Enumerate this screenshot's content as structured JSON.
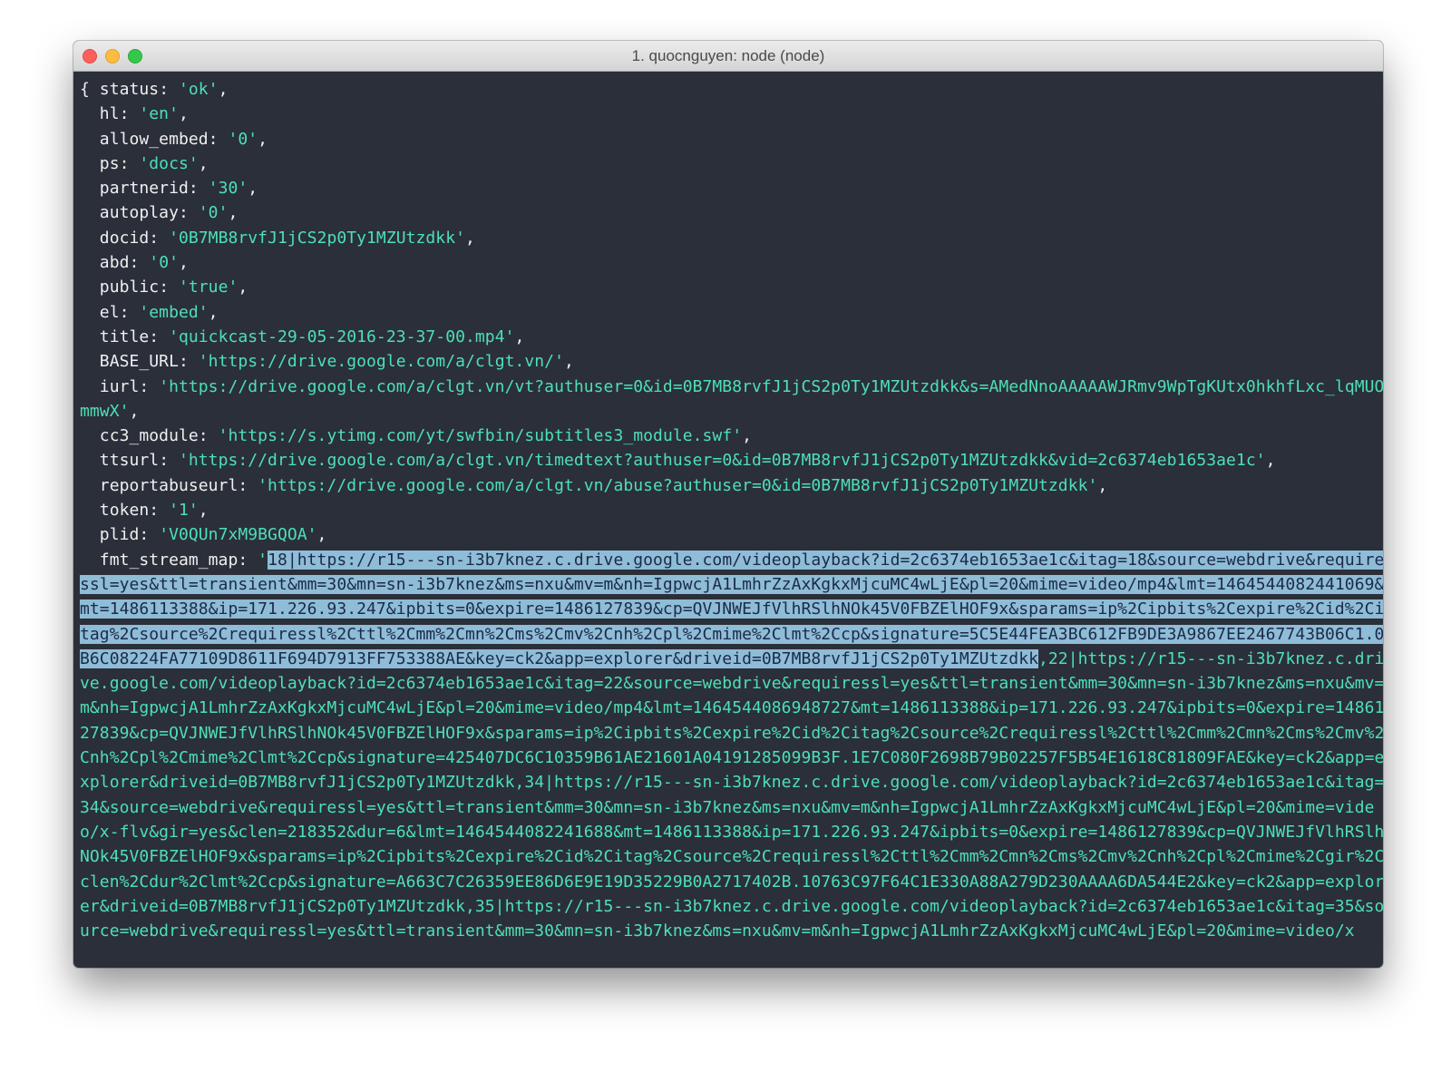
{
  "window": {
    "title": "1. quocnguyen: node (node)"
  },
  "terminal": {
    "open_brace": "{ ",
    "fields": [
      {
        "key": "status",
        "value": "'ok'"
      },
      {
        "key": "hl",
        "value": "'en'"
      },
      {
        "key": "allow_embed",
        "value": "'0'"
      },
      {
        "key": "ps",
        "value": "'docs'"
      },
      {
        "key": "partnerid",
        "value": "'30'"
      },
      {
        "key": "autoplay",
        "value": "'0'"
      },
      {
        "key": "docid",
        "value": "'0B7MB8rvfJ1jCS2p0Ty1MZUtzdkk'"
      },
      {
        "key": "abd",
        "value": "'0'"
      },
      {
        "key": "public",
        "value": "'true'"
      },
      {
        "key": "el",
        "value": "'embed'"
      },
      {
        "key": "title",
        "value": "'quickcast-29-05-2016-23-37-00.mp4'"
      },
      {
        "key": "BASE_URL",
        "value": "'https://drive.google.com/a/clgt.vn/'"
      },
      {
        "key": "iurl",
        "value": "'https://drive.google.com/a/clgt.vn/vt?authuser=0&id=0B7MB8rvfJ1jCS2p0Ty1MZUtzdkk&s=AMedNnoAAAAAWJRmv9WpTgKUtx0hkhfLxc_lqMUOmmwX'"
      },
      {
        "key": "cc3_module",
        "value": "'https://s.ytimg.com/yt/swfbin/subtitles3_module.swf'"
      },
      {
        "key": "ttsurl",
        "value": "'https://drive.google.com/a/clgt.vn/timedtext?authuser=0&id=0B7MB8rvfJ1jCS2p0Ty1MZUtzdkk&vid=2c6374eb1653ae1c'"
      },
      {
        "key": "reportabuseurl",
        "value": "'https://drive.google.com/a/clgt.vn/abuse?authuser=0&id=0B7MB8rvfJ1jCS2p0Ty1MZUtzdkk'"
      },
      {
        "key": "token",
        "value": "'1'"
      },
      {
        "key": "plid",
        "value": "'V0QUn7xM9BGQOA'"
      }
    ],
    "fmt_stream_map": {
      "key": "fmt_stream_map",
      "quote": "'",
      "selected": "18|https://r15---sn-i3b7knez.c.drive.google.com/videoplayback?id=2c6374eb1653ae1c&itag=18&source=webdrive&requiressl=yes&ttl=transient&mm=30&mn=sn-i3b7knez&ms=nxu&mv=m&nh=IgpwcjA1LmhrZzAxKgkxMjcuMC4wLjE&pl=20&mime=video/mp4&lmt=1464544082441069&mt=1486113388&ip=171.226.93.247&ipbits=0&expire=1486127839&cp=QVJNWEJfVlhRSlhNOk45V0FBZElHOF9x&sparams=ip%2Cipbits%2Cexpire%2Cid%2Citag%2Csource%2Crequiressl%2Cttl%2Cmm%2Cmn%2Cms%2Cmv%2Cnh%2Cpl%2Cmime%2Clmt%2Ccp&signature=5C5E44FEA3BC612FB9DE3A9867EE2467743B06C1.0B6C08224FA77109D8611F694D7913FF753388AE&key=ck2&app=explorer&driveid=0B7MB8rvfJ1jCS2p0Ty1MZUtzdkk",
      "rest": ",22|https://r15---sn-i3b7knez.c.drive.google.com/videoplayback?id=2c6374eb1653ae1c&itag=22&source=webdrive&requiressl=yes&ttl=transient&mm=30&mn=sn-i3b7knez&ms=nxu&mv=m&nh=IgpwcjA1LmhrZzAxKgkxMjcuMC4wLjE&pl=20&mime=video/mp4&lmt=1464544086948727&mt=1486113388&ip=171.226.93.247&ipbits=0&expire=1486127839&cp=QVJNWEJfVlhRSlhNOk45V0FBZElHOF9x&sparams=ip%2Cipbits%2Cexpire%2Cid%2Citag%2Csource%2Crequiressl%2Cttl%2Cmm%2Cmn%2Cms%2Cmv%2Cnh%2Cpl%2Cmime%2Clmt%2Ccp&signature=425407DC6C10359B61AE21601A04191285099B3F.1E7C080F2698B79B02257F5B54E1618C81809FAE&key=ck2&app=explorer&driveid=0B7MB8rvfJ1jCS2p0Ty1MZUtzdkk,34|https://r15---sn-i3b7knez.c.drive.google.com/videoplayback?id=2c6374eb1653ae1c&itag=34&source=webdrive&requiressl=yes&ttl=transient&mm=30&mn=sn-i3b7knez&ms=nxu&mv=m&nh=IgpwcjA1LmhrZzAxKgkxMjcuMC4wLjE&pl=20&mime=video/x-flv&gir=yes&clen=218352&dur=6&lmt=1464544082241688&mt=1486113388&ip=171.226.93.247&ipbits=0&expire=1486127839&cp=QVJNWEJfVlhRSlhNOk45V0FBZElHOF9x&sparams=ip%2Cipbits%2Cexpire%2Cid%2Citag%2Csource%2Crequiressl%2Cttl%2Cmm%2Cmn%2Cms%2Cmv%2Cnh%2Cpl%2Cmime%2Cgir%2Cclen%2Cdur%2Clmt%2Ccp&signature=A663C7C26359EE86D6E9E19D35229B0A2717402B.10763C97F64C1E330A88A279D230AAAA6DA544E2&key=ck2&app=explorer&driveid=0B7MB8rvfJ1jCS2p0Ty1MZUtzdkk,35|https://r15---sn-i3b7knez.c.drive.google.com/videoplayback?id=2c6374eb1653ae1c&itag=35&source=webdrive&requiressl=yes&ttl=transient&mm=30&mn=sn-i3b7knez&ms=nxu&mv=m&nh=IgpwcjA1LmhrZzAxKgkxMjcuMC4wLjE&pl=20&mime=video/x"
    }
  },
  "colors": {
    "terminal_background": "#2b2f3a",
    "key_text": "#f0f0f0",
    "string_text": "#4de0b4",
    "selection_background": "#8fbcd6",
    "selection_text": "#1b2a4a"
  }
}
